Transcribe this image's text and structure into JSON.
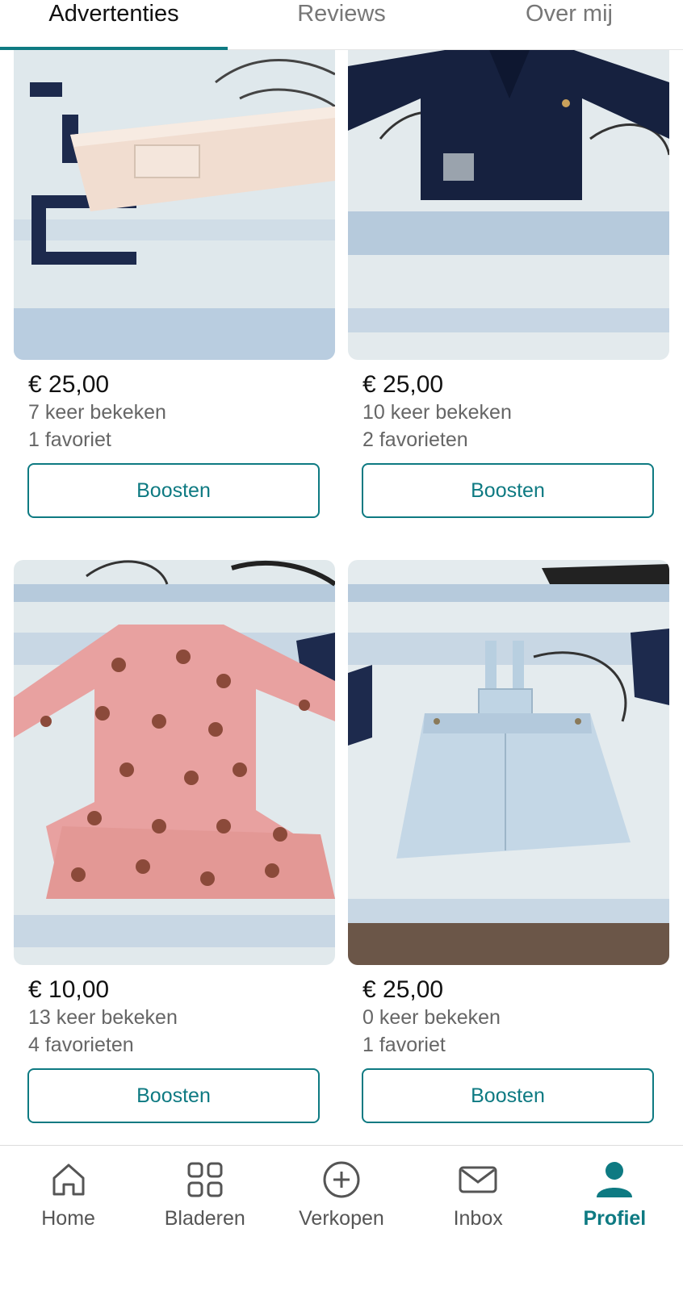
{
  "tabs": [
    {
      "label": "Advertenties"
    },
    {
      "label": "Reviews"
    },
    {
      "label": "Over mij"
    }
  ],
  "listings": [
    {
      "price": "€ 25,00",
      "views": "7 keer bekeken",
      "favorites": "1 favoriet",
      "button": "Boosten",
      "photo": "pink-headband"
    },
    {
      "price": "€ 25,00",
      "views": "10 keer bekeken",
      "favorites": "2 favorieten",
      "button": "Boosten",
      "photo": "navy-cardigan"
    },
    {
      "price": "€ 10,00",
      "views": "13 keer bekeken",
      "favorites": "4 favorieten",
      "button": "Boosten",
      "photo": "pink-dress"
    },
    {
      "price": "€ 25,00",
      "views": "0 keer bekeken",
      "favorites": "1 favoriet",
      "button": "Boosten",
      "photo": "denim-pinafore"
    }
  ],
  "nav": [
    {
      "label": "Home",
      "icon": "home-icon"
    },
    {
      "label": "Bladeren",
      "icon": "grid-icon"
    },
    {
      "label": "Verkopen",
      "icon": "plus-circle-icon"
    },
    {
      "label": "Inbox",
      "icon": "mail-icon"
    },
    {
      "label": "Profiel",
      "icon": "person-icon"
    }
  ],
  "colors": {
    "accent": "#0e7a82",
    "muted_text": "#666666"
  }
}
